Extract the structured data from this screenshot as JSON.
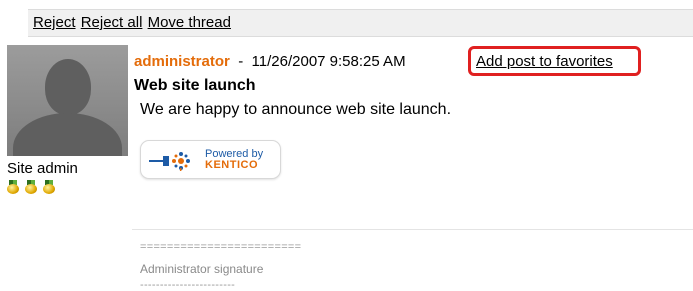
{
  "toolbar": {
    "reject_label": "Reject",
    "reject_all_label": "Reject all",
    "move_thread_label": "Move thread"
  },
  "user": {
    "name": "Site admin",
    "medals": [
      "gold-medal-icon",
      "gold-medal-icon",
      "gold-medal-icon"
    ]
  },
  "post": {
    "author": "administrator",
    "separator": "-",
    "date": "11/26/2007 9:58:25 AM",
    "favorites_label": "Add post to favorites",
    "title": "Web site launch",
    "text": "We are happy to announce web site launch.",
    "badge": {
      "powered_by": "Powered by",
      "brand": "KENTICO"
    }
  },
  "signature": {
    "top_line": "========================",
    "text": "Administrator signature",
    "bottom_line": "------------------------"
  },
  "colors": {
    "author": "#e46c0a",
    "highlight_box": "#e02020",
    "toolbar_bg": "#f0f0f0"
  }
}
